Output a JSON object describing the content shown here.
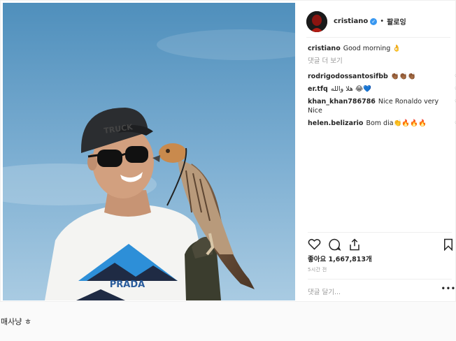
{
  "post": {
    "username": "cristiano",
    "verified_glyph": "✓",
    "separator": "•",
    "follow_label": "팔로잉",
    "caption_user": "cristiano",
    "caption_text": "Good morning 👌",
    "view_more": "댓글 더 보기",
    "comments": [
      {
        "user": "rodrigodossantosifbb",
        "text": "👏🏾👏🏾👏🏾"
      },
      {
        "user": "er.tfq",
        "text": "هلا والله 😂💙"
      },
      {
        "user": "khan_khan786786",
        "text": "Nice Ronaldo very Nice"
      },
      {
        "user": "helen.belizario",
        "text": "Bom dia👏🔥🔥🔥"
      }
    ],
    "likes": "좋아요 1,667,813개",
    "time": "5시간 전",
    "add_comment": "댓글 달기...",
    "more_dots": "•••",
    "photo": {
      "cap_text": "TRUCK",
      "shirt_brand": "PRADA"
    }
  },
  "page": {
    "caption": "매사냥 ㅎ"
  },
  "icons": [
    "heart-icon",
    "comment-icon",
    "share-icon",
    "bookmark-icon",
    "verified-icon",
    "avatar"
  ]
}
